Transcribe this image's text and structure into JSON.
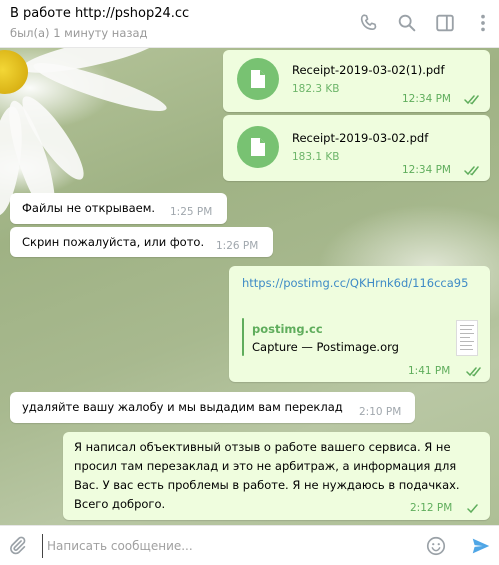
{
  "header": {
    "title": "В работе http://pshop24.cc",
    "status": "был(а) 1 минуту назад",
    "icons": [
      "phone-icon",
      "search-icon",
      "sidebar-icon",
      "more-icon"
    ]
  },
  "messages": {
    "file1": {
      "name": "Receipt-2019-03-02(1).pdf",
      "size": "182.3 KB",
      "time": "12:34 PM"
    },
    "file2": {
      "name": "Receipt-2019-03-02.pdf",
      "size": "183.1 KB",
      "time": "12:34 PM"
    },
    "in1": {
      "text": "Файлы не открываем.",
      "time": "1:25 PM"
    },
    "in2": {
      "text": "Скрин пожалуйста, или фото.",
      "time": "1:26 PM"
    },
    "link": {
      "url": "https://postimg.cc/QKHrnk6d/116cca95",
      "site": "postimg.cc",
      "title": "Capture — Postimage.org",
      "time": "1:41 PM"
    },
    "in3": {
      "text": "удаляйте вашу жалобу и мы  выдадим вам переклад",
      "time": "2:10 PM"
    },
    "out_long": {
      "line1": "Я написал объективный отзыв о работе вашего сервиса. Я не",
      "line2": "просил там перезаклад и это не арбитраж, а информация для",
      "line3": "Вас. У вас есть проблемы в работе. Я не нуждаюсь в подачках.",
      "line4": "Всего доброго.",
      "time": "2:12 PM"
    }
  },
  "composer": {
    "placeholder": "Написать сообщение...",
    "icons": [
      "attach-icon",
      "emoji-icon",
      "send-icon"
    ]
  },
  "colors": {
    "outgoing_bubble": "#effdde",
    "incoming_bubble": "#ffffff",
    "accent_green": "#5fad5c",
    "link_blue": "#3f8bc6",
    "send_blue": "#4fa6e6"
  }
}
